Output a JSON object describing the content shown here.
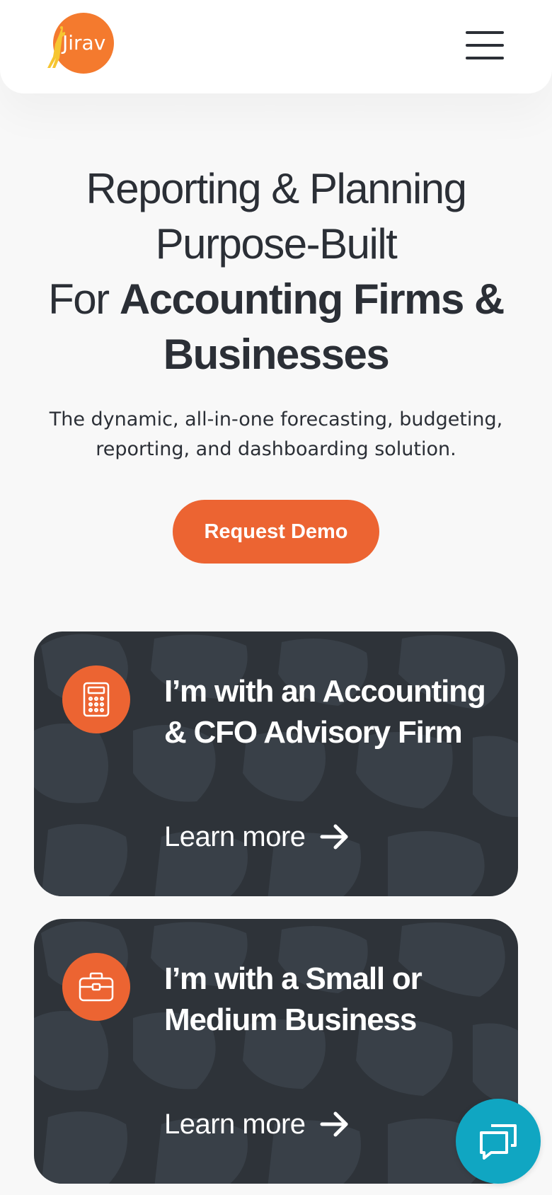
{
  "header": {
    "logo_text": "Jirav",
    "logo_color": "#f47a2e",
    "menu_icon": "hamburger-menu-icon"
  },
  "hero": {
    "title_line1": "Reporting & Planning",
    "title_line2": "Purpose-Built",
    "title_line3_prefix": "For ",
    "title_line3_bold": "Accounting Firms &",
    "title_line4_bold": "Businesses",
    "subtitle_line1": "The dynamic, all-in-one forecasting, budgeting,",
    "subtitle_line2": "reporting, and dashboarding solution.",
    "cta_label": "Request Demo"
  },
  "cards": [
    {
      "icon": "calculator-icon",
      "title_line1": "I’m with an Accounting",
      "title_line2": "& CFO Advisory Firm",
      "link_label": "Learn more",
      "link_icon": "arrow-right-icon"
    },
    {
      "icon": "briefcase-icon",
      "title_line1": "I’m with a Small or",
      "title_line2": "Medium Business",
      "link_label": "Learn more",
      "link_icon": "arrow-right-icon"
    }
  ],
  "chat": {
    "icon": "chat-bubbles-icon"
  },
  "colors": {
    "accent": "#ec6432",
    "card_bg": "#2e3339",
    "chat_bg": "#10a6c2",
    "text": "#2b2f36"
  }
}
